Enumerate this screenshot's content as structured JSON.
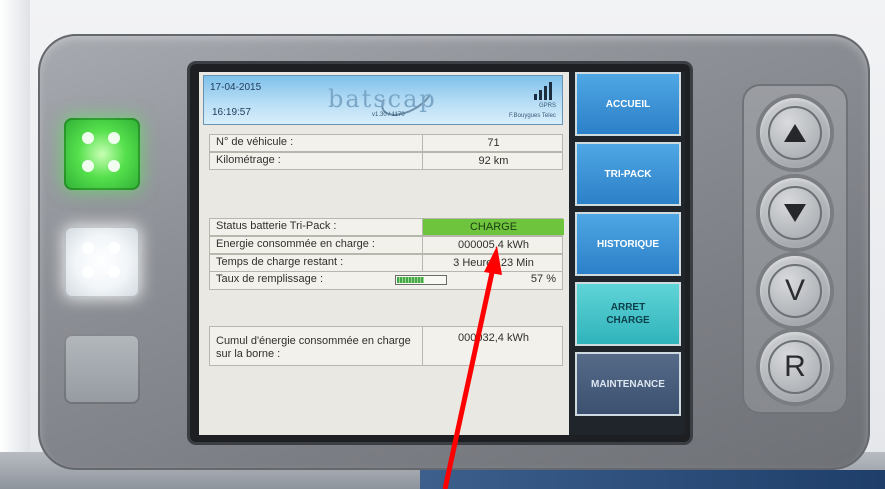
{
  "header": {
    "date": "17-04-2015",
    "time": "16:19:57",
    "logo": "batscap",
    "version": "v1.30 / 1170",
    "network": "GPRS",
    "operator": "F.Bouygues Telec"
  },
  "rows": {
    "vehicle_label": "N° de véhicule :",
    "vehicle_value": "71",
    "mileage_label": "Kilométrage :",
    "mileage_value": "92 km",
    "status_label": "Status batterie Tri-Pack :",
    "status_value": "CHARGE",
    "energy_label": "Energie consommée en charge :",
    "energy_value": "000005,4 kWh",
    "time_left_label": "Temps de charge restant :",
    "time_left_value": "3 Heures 23 Min",
    "fill_label": "Taux de remplissage :",
    "fill_percent": 57,
    "fill_text": "57 %",
    "cumul_label": "Cumul d'énergie consommée en charge sur la borne :",
    "cumul_value": "000032,4 kWh"
  },
  "menu": {
    "home": "ACCUEIL",
    "tripack": "TRI-PACK",
    "history": "HISTORIQUE",
    "stop_line1": "ARRET",
    "stop_line2": "CHARGE",
    "maintenance": "MAINTENANCE"
  },
  "keypad": {
    "up_icon": "up-triangle-icon",
    "down_icon": "down-triangle-icon",
    "v_label": "V",
    "r_label": "R"
  },
  "colors": {
    "charge_green": "#6fc43e",
    "menu_blue": "#2c80c8",
    "menu_cyan": "#30b3bb",
    "led_green": "#55e04c",
    "annotation_red": "#ff0000"
  }
}
